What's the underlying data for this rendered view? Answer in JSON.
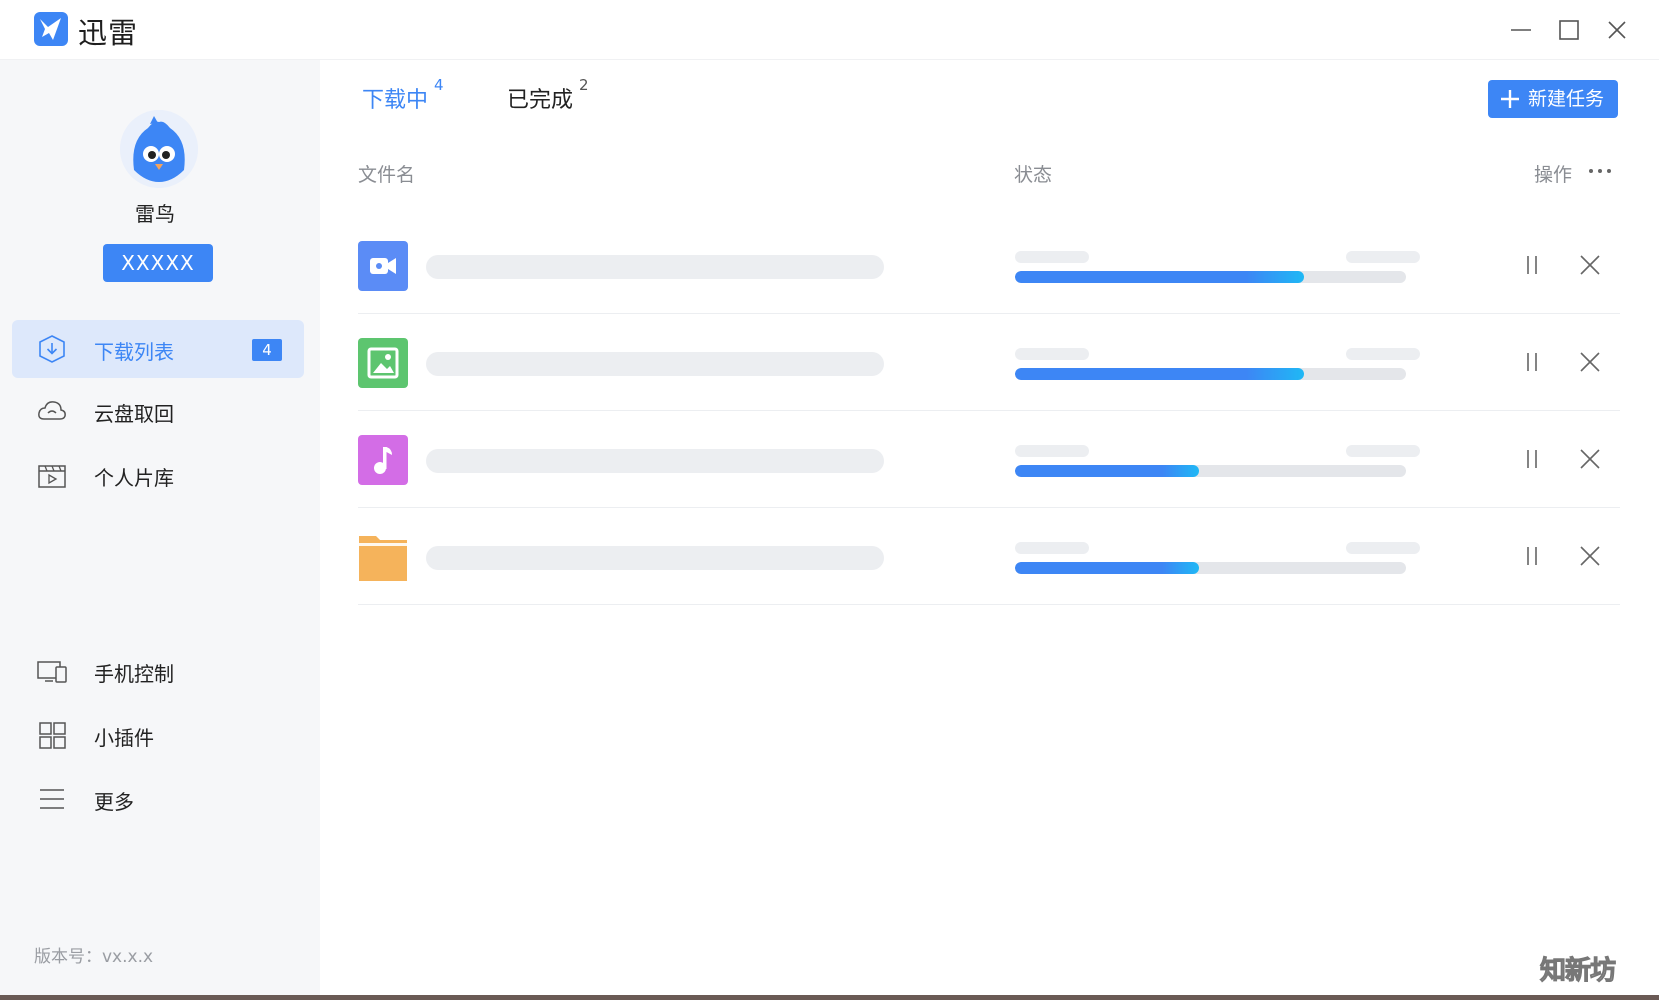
{
  "app": {
    "title": "迅雷"
  },
  "colors": {
    "accent": "#3d86f5",
    "progress_end": "#1fb8f5",
    "sidebar_bg": "#f6f7f9"
  },
  "user": {
    "name": "雷鸟",
    "badge": "XXXXX"
  },
  "sidebar": {
    "top_items": [
      {
        "label": "下载列表",
        "icon": "download-shield-icon",
        "count": "4",
        "active": true
      },
      {
        "label": "云盘取回",
        "icon": "cloud-icon"
      },
      {
        "label": "个人片库",
        "icon": "video-library-icon"
      }
    ],
    "bottom_items": [
      {
        "label": "手机控制",
        "icon": "phone-control-icon"
      },
      {
        "label": "小插件",
        "icon": "grid-icon"
      },
      {
        "label": "更多",
        "icon": "menu-icon"
      }
    ],
    "version": "版本号：vx.x.x"
  },
  "tabs": [
    {
      "label": "下载中",
      "count": "4",
      "active": true
    },
    {
      "label": "已完成",
      "count": "2",
      "active": false
    }
  ],
  "toolbar": {
    "new_task_label": "新建任务"
  },
  "table": {
    "headers": {
      "filename": "文件名",
      "status": "状态",
      "actions": "操作"
    },
    "rows": [
      {
        "type": "video",
        "icon": "video-file-icon",
        "icon_color": "#5b8cf6",
        "progress": 0.74
      },
      {
        "type": "image",
        "icon": "image-file-icon",
        "icon_color": "#5dc56f",
        "progress": 0.74
      },
      {
        "type": "audio",
        "icon": "music-file-icon",
        "icon_color": "#d36de6",
        "progress": 0.47
      },
      {
        "type": "folder",
        "icon": "folder-icon",
        "icon_color": "#f5b35b",
        "progress": 0.47
      }
    ]
  },
  "watermark": "知新坊"
}
